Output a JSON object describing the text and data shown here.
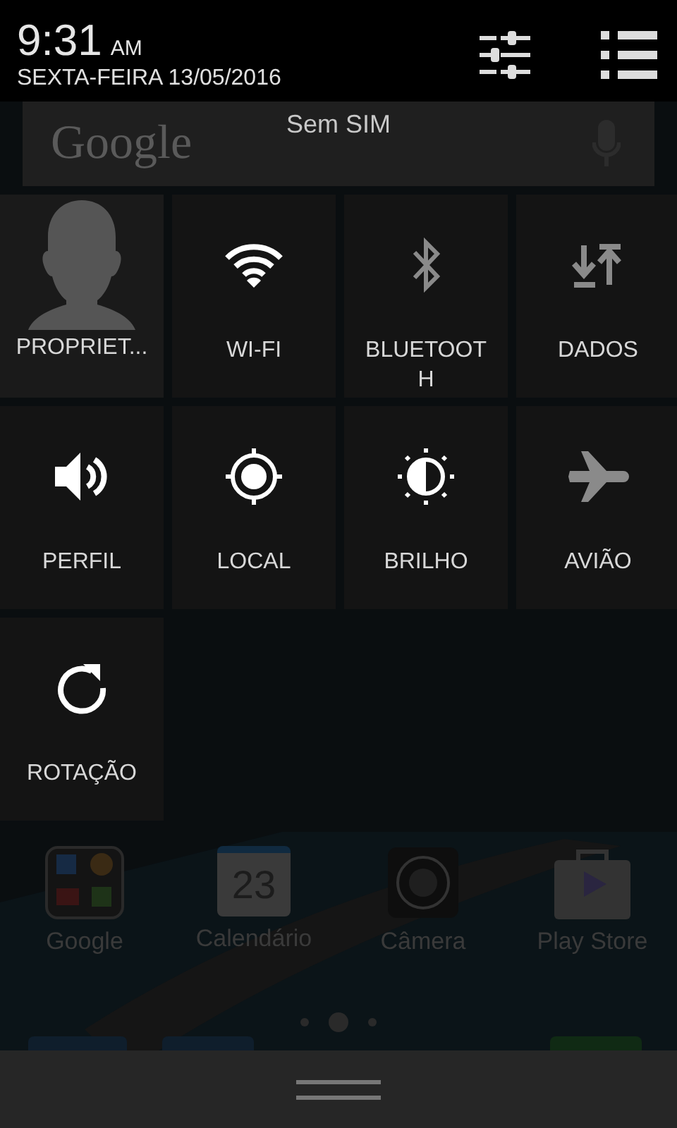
{
  "status": {
    "time": "9:31",
    "ampm": "AM",
    "date": "SEXTA-FEIRA 13/05/2016"
  },
  "carrier": "Sem SIM",
  "home": {
    "search_logo": "Google",
    "apps": [
      {
        "label": "Google"
      },
      {
        "label": "Calendário",
        "badge": "23"
      },
      {
        "label": "Câmera"
      },
      {
        "label": "Play Store"
      }
    ]
  },
  "tiles": [
    {
      "kind": "avatar",
      "label": "PROPRIET..."
    },
    {
      "kind": "toggle",
      "label": "WI-FI",
      "on": true
    },
    {
      "kind": "toggle",
      "label": "BLUETOOTH",
      "on": false
    },
    {
      "kind": "toggle",
      "label": "DADOS",
      "on": false
    },
    {
      "kind": "toggle",
      "label": "PERFIL",
      "on": true
    },
    {
      "kind": "toggle",
      "label": "LOCAL",
      "on": true
    },
    {
      "kind": "toggle",
      "label": "BRILHO",
      "on": true
    },
    {
      "kind": "toggle",
      "label": "AVIÃO",
      "on": false
    },
    {
      "kind": "toggle",
      "label": "ROTAÇÃO",
      "on": true
    }
  ]
}
